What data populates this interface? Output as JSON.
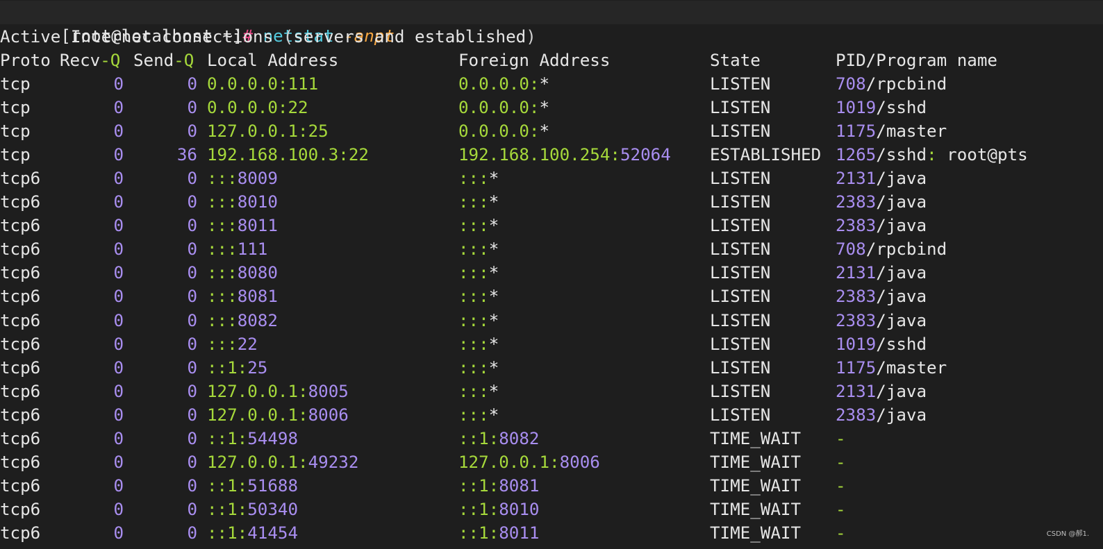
{
  "prompt": {
    "open_bracket": "[",
    "user_host": "root@localhost ~",
    "close_bracket": "]",
    "hash": "#",
    "command": "netstat",
    "flags": "-anpt"
  },
  "banner": {
    "prefix": "Active Internet connections ",
    "open_paren": "(",
    "inner": "servers and established",
    "close_paren": ")"
  },
  "headers": {
    "proto": "Proto",
    "recvq_a": "Recv",
    "recvq_b": "-Q",
    "sendq_a": "Send",
    "sendq_b": "-Q",
    "local": "Local Address",
    "foreign": "Foreign Address",
    "state": "State",
    "prog": "PID/Program name"
  },
  "rows": [
    {
      "proto": "tcp",
      "recvq": "0",
      "sendq": "0",
      "local_ip": "0.0.0.0:111",
      "local_port": "",
      "foreign_ip": "0.0.0.0:",
      "foreign_port": "*",
      "state": "LISTEN",
      "pid": "708",
      "sep": "/",
      "prog": "rpcbind"
    },
    {
      "proto": "tcp",
      "recvq": "0",
      "sendq": "0",
      "local_ip": "0.0.0.0:22",
      "local_port": "",
      "foreign_ip": "0.0.0.0:",
      "foreign_port": "*",
      "state": "LISTEN",
      "pid": "1019",
      "sep": "/",
      "prog": "sshd"
    },
    {
      "proto": "tcp",
      "recvq": "0",
      "sendq": "0",
      "local_ip": "127.0.0.1:25",
      "local_port": "",
      "foreign_ip": "0.0.0.0:",
      "foreign_port": "*",
      "state": "LISTEN",
      "pid": "1175",
      "sep": "/",
      "prog": "master"
    },
    {
      "proto": "tcp",
      "recvq": "0",
      "sendq": "36",
      "local_ip": "192.168.100.3:22",
      "local_port": "",
      "foreign_ip": "192.168.100.254:",
      "foreign_port": "52064",
      "state": "ESTABLISHED",
      "pid": "1265",
      "sep": "/",
      "prog": "sshd: root@pts"
    },
    {
      "proto": "tcp6",
      "recvq": "0",
      "sendq": "0",
      "local_ip": ":::",
      "local_port": "8009",
      "foreign_ip": ":::",
      "foreign_port": "*",
      "state": "LISTEN",
      "pid": "2131",
      "sep": "/",
      "prog": "java"
    },
    {
      "proto": "tcp6",
      "recvq": "0",
      "sendq": "0",
      "local_ip": ":::",
      "local_port": "8010",
      "foreign_ip": ":::",
      "foreign_port": "*",
      "state": "LISTEN",
      "pid": "2383",
      "sep": "/",
      "prog": "java"
    },
    {
      "proto": "tcp6",
      "recvq": "0",
      "sendq": "0",
      "local_ip": ":::",
      "local_port": "8011",
      "foreign_ip": ":::",
      "foreign_port": "*",
      "state": "LISTEN",
      "pid": "2383",
      "sep": "/",
      "prog": "java"
    },
    {
      "proto": "tcp6",
      "recvq": "0",
      "sendq": "0",
      "local_ip": ":::",
      "local_port": "111",
      "foreign_ip": ":::",
      "foreign_port": "*",
      "state": "LISTEN",
      "pid": "708",
      "sep": "/",
      "prog": "rpcbind"
    },
    {
      "proto": "tcp6",
      "recvq": "0",
      "sendq": "0",
      "local_ip": ":::",
      "local_port": "8080",
      "foreign_ip": ":::",
      "foreign_port": "*",
      "state": "LISTEN",
      "pid": "2131",
      "sep": "/",
      "prog": "java"
    },
    {
      "proto": "tcp6",
      "recvq": "0",
      "sendq": "0",
      "local_ip": ":::",
      "local_port": "8081",
      "foreign_ip": ":::",
      "foreign_port": "*",
      "state": "LISTEN",
      "pid": "2383",
      "sep": "/",
      "prog": "java"
    },
    {
      "proto": "tcp6",
      "recvq": "0",
      "sendq": "0",
      "local_ip": ":::",
      "local_port": "8082",
      "foreign_ip": ":::",
      "foreign_port": "*",
      "state": "LISTEN",
      "pid": "2383",
      "sep": "/",
      "prog": "java"
    },
    {
      "proto": "tcp6",
      "recvq": "0",
      "sendq": "0",
      "local_ip": ":::",
      "local_port": "22",
      "foreign_ip": ":::",
      "foreign_port": "*",
      "state": "LISTEN",
      "pid": "1019",
      "sep": "/",
      "prog": "sshd"
    },
    {
      "proto": "tcp6",
      "recvq": "0",
      "sendq": "0",
      "local_ip": "::1:",
      "local_port": "25",
      "foreign_ip": ":::",
      "foreign_port": "*",
      "state": "LISTEN",
      "pid": "1175",
      "sep": "/",
      "prog": "master"
    },
    {
      "proto": "tcp6",
      "recvq": "0",
      "sendq": "0",
      "local_ip": "127.0.0.1:",
      "local_port": "8005",
      "foreign_ip": ":::",
      "foreign_port": "*",
      "state": "LISTEN",
      "pid": "2131",
      "sep": "/",
      "prog": "java"
    },
    {
      "proto": "tcp6",
      "recvq": "0",
      "sendq": "0",
      "local_ip": "127.0.0.1:",
      "local_port": "8006",
      "foreign_ip": ":::",
      "foreign_port": "*",
      "state": "LISTEN",
      "pid": "2383",
      "sep": "/",
      "prog": "java"
    },
    {
      "proto": "tcp6",
      "recvq": "0",
      "sendq": "0",
      "local_ip": "::1:",
      "local_port": "54498",
      "foreign_ip": "::1:",
      "foreign_port": "8082",
      "state": "TIME_WAIT",
      "pid": "",
      "sep": "-",
      "prog": ""
    },
    {
      "proto": "tcp6",
      "recvq": "0",
      "sendq": "0",
      "local_ip": "127.0.0.1:",
      "local_port": "49232",
      "foreign_ip": "127.0.0.1:",
      "foreign_port": "8006",
      "state": "TIME_WAIT",
      "pid": "",
      "sep": "-",
      "prog": ""
    },
    {
      "proto": "tcp6",
      "recvq": "0",
      "sendq": "0",
      "local_ip": "::1:",
      "local_port": "51688",
      "foreign_ip": "::1:",
      "foreign_port": "8081",
      "state": "TIME_WAIT",
      "pid": "",
      "sep": "-",
      "prog": ""
    },
    {
      "proto": "tcp6",
      "recvq": "0",
      "sendq": "0",
      "local_ip": "::1:",
      "local_port": "50340",
      "foreign_ip": "::1:",
      "foreign_port": "8010",
      "state": "TIME_WAIT",
      "pid": "",
      "sep": "-",
      "prog": ""
    },
    {
      "proto": "tcp6",
      "recvq": "0",
      "sendq": "0",
      "local_ip": "::1:",
      "local_port": "41454",
      "foreign_ip": "::1:",
      "foreign_port": "8011",
      "state": "TIME_WAIT",
      "pid": "",
      "sep": "-",
      "prog": ""
    }
  ],
  "watermark": "CSDN @郝1.",
  "colors": {
    "background": "#1e1e1e",
    "text": "#e6e6e6",
    "green": "#a6d93b",
    "purple": "#a98ef0",
    "cyan": "#52c9dd",
    "orange": "#f6a640",
    "pink": "#f04a8a"
  }
}
